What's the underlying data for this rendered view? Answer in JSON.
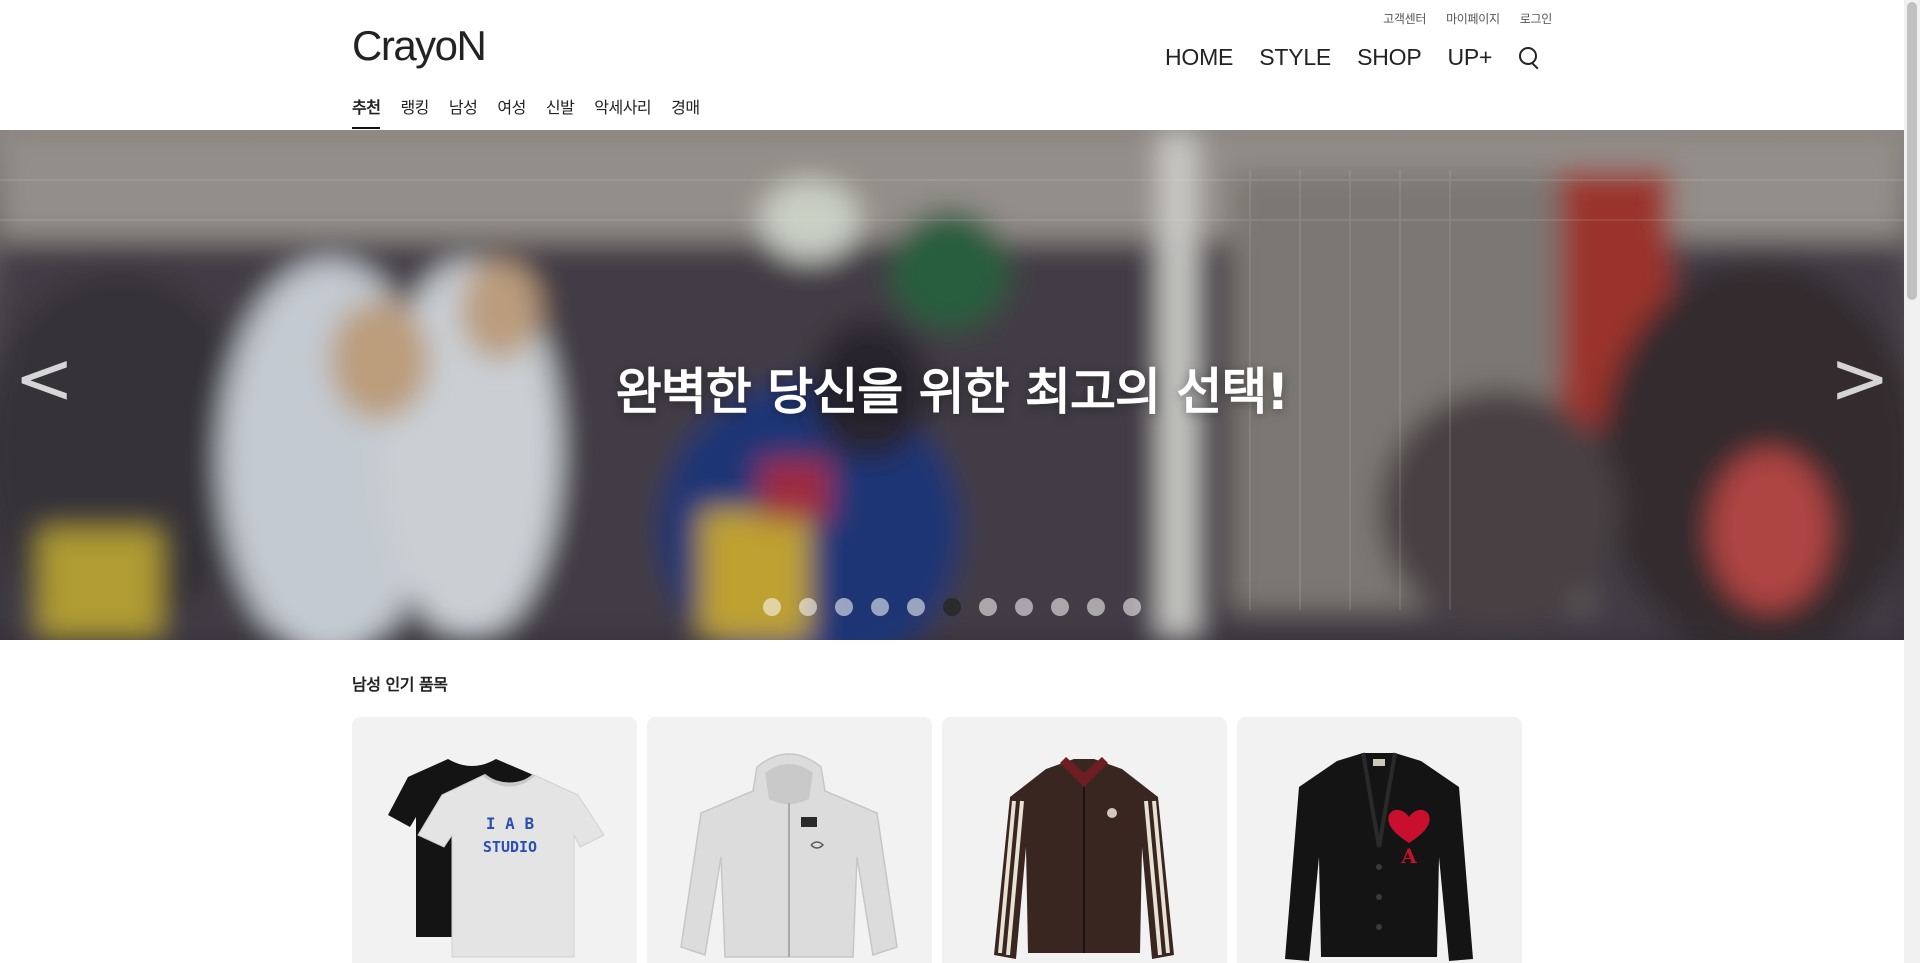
{
  "header": {
    "logo": "CrayoN",
    "util_links": [
      "고객센터",
      "마이페이지",
      "로그인"
    ],
    "nav": [
      "HOME",
      "STYLE",
      "SHOP",
      "UP+"
    ],
    "search_icon": "search-icon"
  },
  "categories": [
    {
      "label": "추천",
      "active": true
    },
    {
      "label": "랭킹",
      "active": false
    },
    {
      "label": "남성",
      "active": false
    },
    {
      "label": "여성",
      "active": false
    },
    {
      "label": "신발",
      "active": false
    },
    {
      "label": "악세사리",
      "active": false
    },
    {
      "label": "경매",
      "active": false
    }
  ],
  "hero": {
    "title": "완벽한 당신을 위한 최고의 선택!",
    "prev_icon": "chevron-left-icon",
    "next_icon": "chevron-right-icon",
    "prev_glyph": "<",
    "next_glyph": ">",
    "slide_count": 11,
    "active_slide": 6
  },
  "section": {
    "title": "남성 인기 품목",
    "products": [
      {
        "name": "iab-studio-tshirt-pair",
        "print_line1": "I A B",
        "print_line2": "STUDIO"
      },
      {
        "name": "grey-zip-hoodie"
      },
      {
        "name": "brown-track-jacket"
      },
      {
        "name": "black-heart-cardigan",
        "emblem": "A"
      }
    ]
  },
  "colors": {
    "text": "#222222",
    "card_bg": "#f2f2f2",
    "accent_red": "#c8102e",
    "print_blue": "#2b4fb4"
  }
}
